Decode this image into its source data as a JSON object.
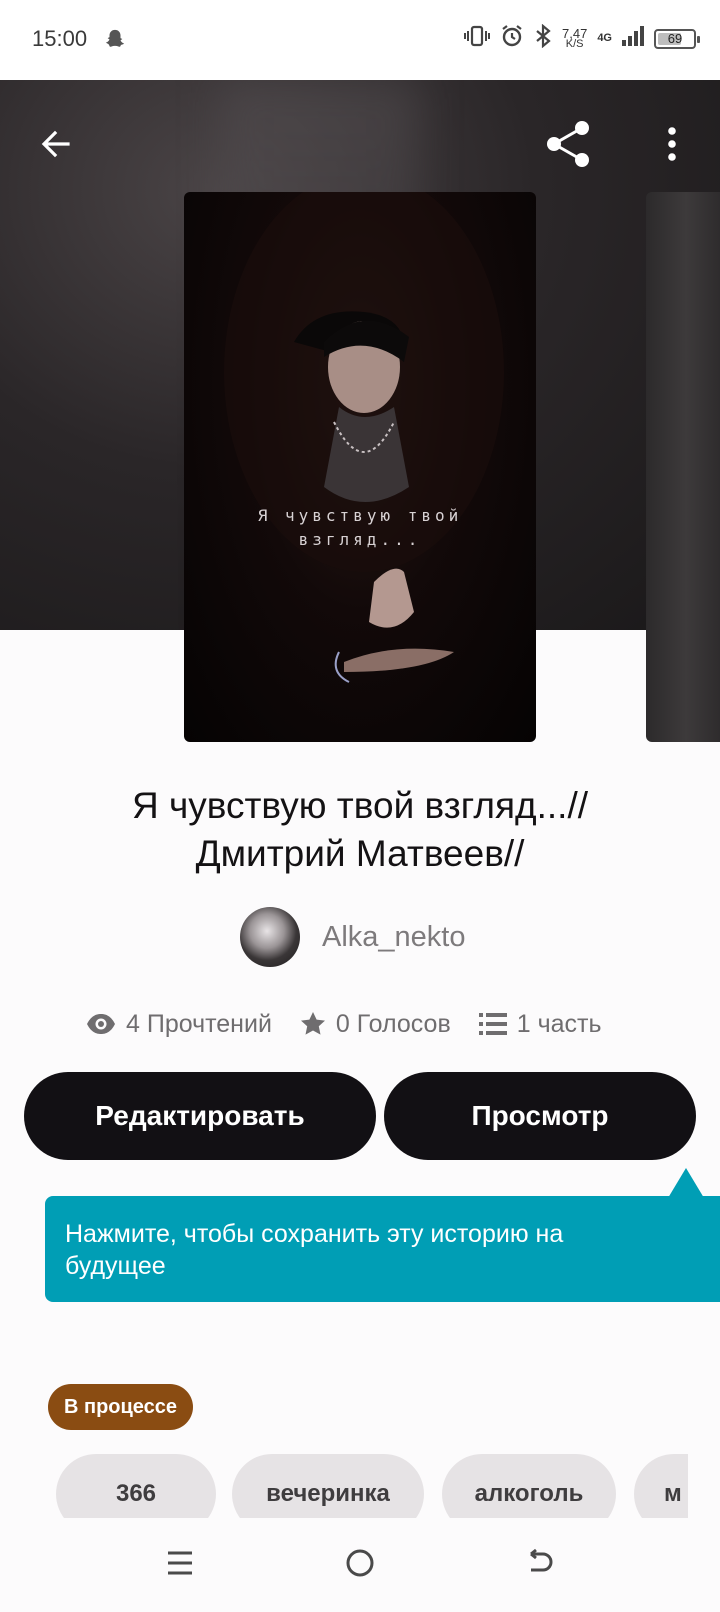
{
  "status_bar": {
    "time": "15:00",
    "speed_value": "7,47",
    "speed_unit": "K/S",
    "network": "4G",
    "battery": "69",
    "battery_level": 0.69
  },
  "story": {
    "title_line1": "Я чувствую твой взгляд...//",
    "title_line2": "Дмитрий Матвеев//",
    "cover_line1": "Я чувствую твой",
    "cover_line2": "взгляд...",
    "author": "Alka_nekto"
  },
  "stats": {
    "reads": "4 Прочтений",
    "votes": "0 Голосов",
    "parts": "1 часть"
  },
  "actions": {
    "edit_label": "Редактировать",
    "view_label": "Просмотр"
  },
  "tooltip": {
    "text": "Нажмите, чтобы сохранить эту историю на будущее",
    "color": "#009eb5"
  },
  "status_badge": {
    "label": "В процессе",
    "color": "#8a4c12"
  },
  "tags": [
    "366",
    "вечеринка",
    "алкоголь",
    "м"
  ],
  "icons": {
    "back": "arrow-left-icon",
    "share": "share-icon",
    "more": "more-vertical-icon",
    "reads": "eye-icon",
    "votes": "star-icon",
    "parts": "list-icon"
  }
}
